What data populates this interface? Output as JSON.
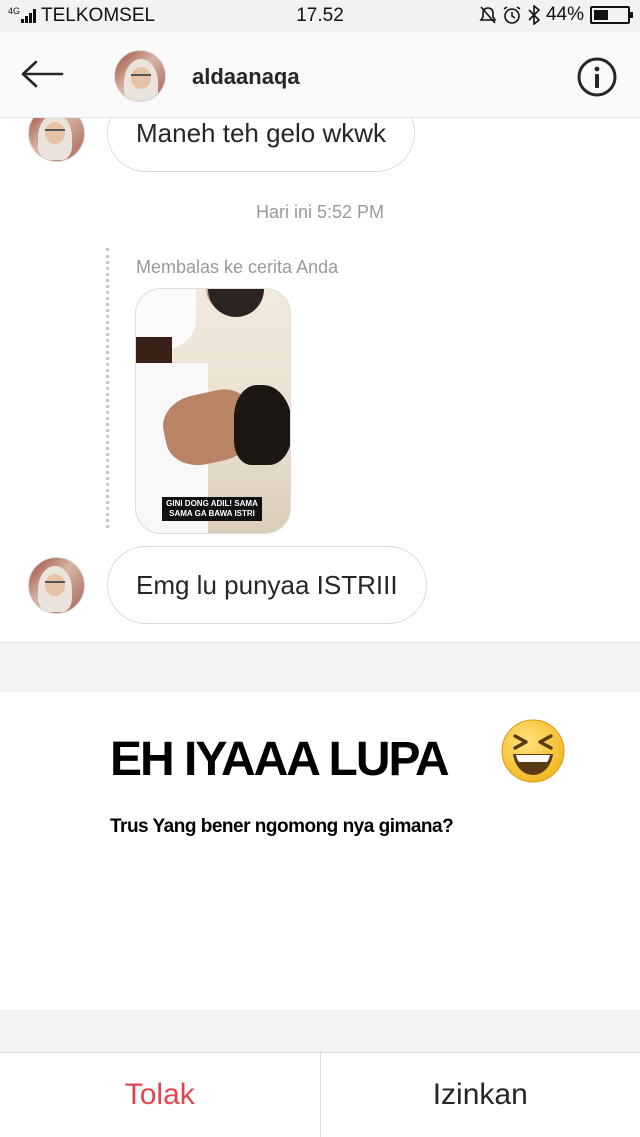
{
  "status_bar": {
    "network": "4G",
    "carrier": "TELKOMSEL",
    "time": "17.52",
    "battery": "44%",
    "battery_level": 0.44,
    "icons": [
      "signal-icon",
      "mute-icon",
      "alarm-icon",
      "bluetooth-icon",
      "battery-icon"
    ]
  },
  "header": {
    "username": "aldaanaqa",
    "icons": [
      "back-arrow-icon",
      "info-icon"
    ]
  },
  "chat": {
    "messages": [
      {
        "text": "Maneh teh gelo wkwk"
      },
      {
        "text": "Emg lu punyaa ISTRIII"
      }
    ],
    "timestamp": "Hari ini 5:52 PM",
    "reply_label": "Membalas ke cerita Anda",
    "story_caption": "GINI DONG ADIL! SAMA SAMA GA BAWA ISTRI"
  },
  "meme": {
    "headline": "EH IYAAA LUPA",
    "emoji": "grinning-squinting-face",
    "subline": "Trus Yang bener ngomong nya gimana?"
  },
  "actions": {
    "deny": "Tolak",
    "allow": "Izinkan",
    "deny_color": "#e0464f"
  }
}
